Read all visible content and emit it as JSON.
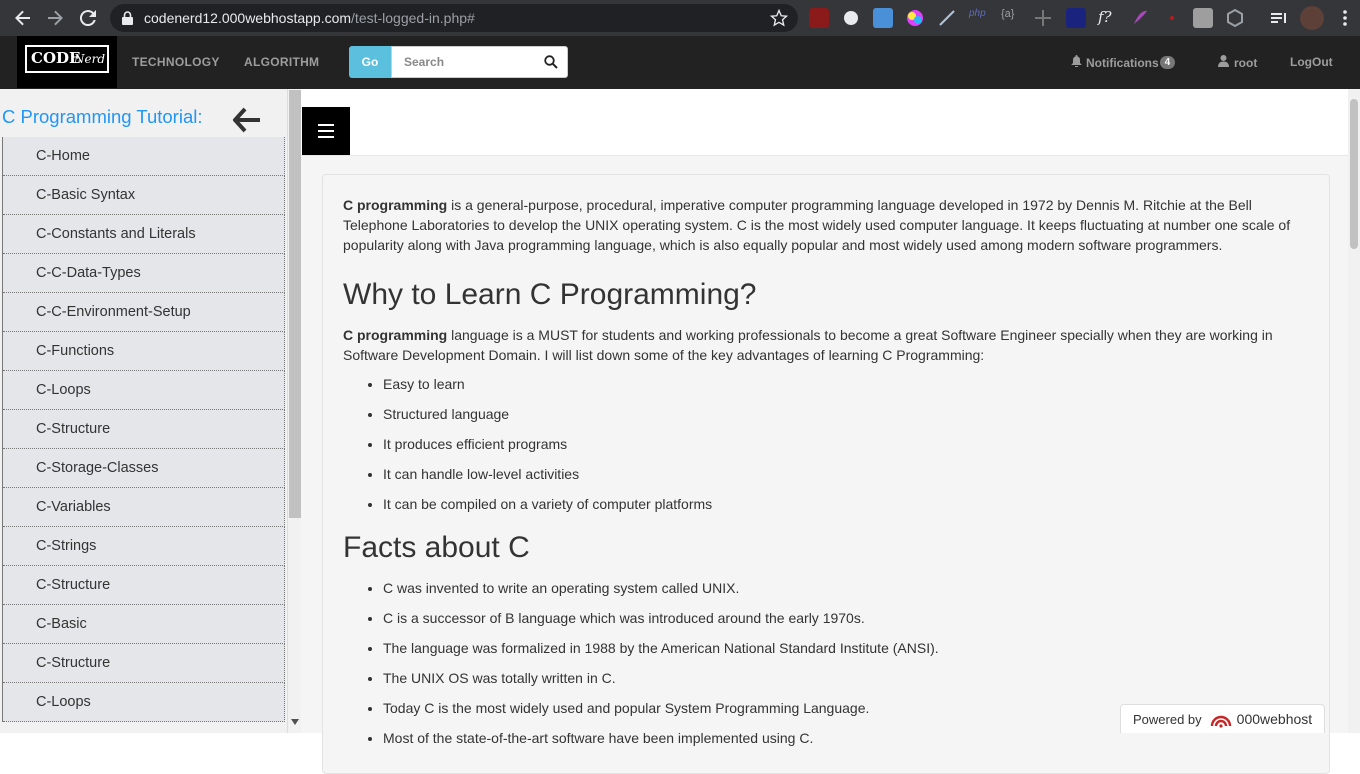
{
  "browser": {
    "url_host": "codenerd12.000webhostapp.com",
    "url_path": "/test-logged-in.php#"
  },
  "site": {
    "logo_code": "CODE",
    "logo_nerd": "Nerd",
    "nav": {
      "technology": "TECHNOLOGY",
      "algorithm": "ALGORITHM",
      "go": "Go",
      "search_placeholder": "Search",
      "notifications": "Notifications",
      "notifications_count": "4",
      "user": "root",
      "logout": "LogOut"
    }
  },
  "sidebar": {
    "title": "C Programming Tutorial:",
    "items": [
      "C-Home",
      "C-Basic Syntax",
      "C-Constants and Literals",
      "C-C-Data-Types",
      "C-C-Environment-Setup",
      "C-Functions",
      "C-Loops",
      "C-Structure",
      "C-Storage-Classes",
      "C-Variables",
      "C-Strings",
      "C-Structure",
      "C-Basic",
      "C-Structure",
      "C-Loops"
    ]
  },
  "content": {
    "intro_bold": "C programming",
    "intro_rest": " is a general-purpose, procedural, imperative computer programming language developed in 1972 by Dennis M. Ritchie at the Bell Telephone Laboratories to develop the UNIX operating system. C is the most widely used computer language. It keeps fluctuating at number one scale of popularity along with Java programming language, which is also equally popular and most widely used among modern software programmers.",
    "why_heading": "Why to Learn C Programming?",
    "why_bold": "C programming",
    "why_rest": " language is a MUST for students and working professionals to become a great Software Engineer specially when they are working in Software Development Domain. I will list down some of the key advantages of learning C Programming:",
    "advantages": [
      "Easy to learn",
      "Structured language",
      "It produces efficient programs",
      "It can handle low-level activities",
      "It can be compiled on a variety of computer platforms"
    ],
    "facts_heading": "Facts about C",
    "facts": [
      "C was invented to write an operating system called UNIX.",
      "C is a successor of B language which was introduced around the early 1970s.",
      "The language was formalized in 1988 by the American National Standard Institute (ANSI).",
      "The UNIX OS was totally written in C.",
      "Today C is the most widely used and popular System Programming Language.",
      "Most of the state-of-the-art software have been implemented using C."
    ]
  },
  "footer_badge": {
    "powered": "Powered by",
    "brand": "000webhost"
  }
}
